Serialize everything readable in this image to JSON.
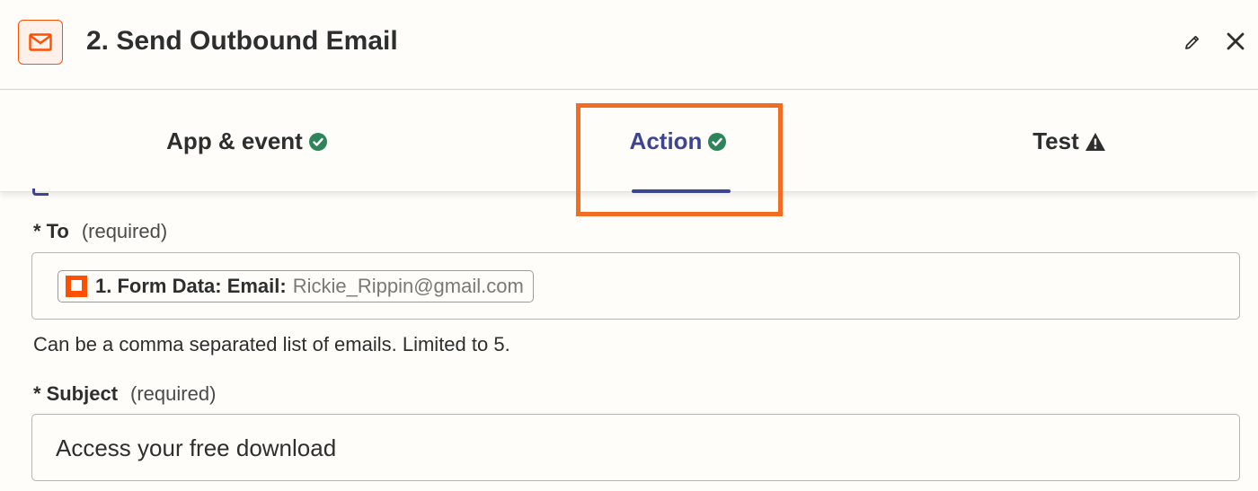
{
  "header": {
    "title": "2. Send Outbound Email",
    "app_icon": "mail-icon",
    "edit_icon": "pencil-icon",
    "close_icon": "close-icon"
  },
  "tabs": [
    {
      "label": "App & event",
      "status": "complete",
      "icon": "check-circle-icon"
    },
    {
      "label": "Action",
      "status": "complete",
      "icon": "check-circle-icon",
      "active": true
    },
    {
      "label": "Test",
      "status": "warning",
      "icon": "warning-icon"
    }
  ],
  "fields": {
    "to": {
      "required_marker": "*",
      "label": "To",
      "required_text": "(required)",
      "pill_key": "1. Form Data: Email:",
      "pill_value": "Rickie_Rippin@gmail.com",
      "helper": "Can be a comma separated list of emails. Limited to 5."
    },
    "subject": {
      "required_marker": "*",
      "label": "Subject",
      "required_text": "(required)",
      "value": "Access your free download"
    }
  },
  "colors": {
    "accent": "#3d4592",
    "brand": "#ff4f00",
    "success": "#2f855a",
    "highlight": "#f26c21"
  }
}
